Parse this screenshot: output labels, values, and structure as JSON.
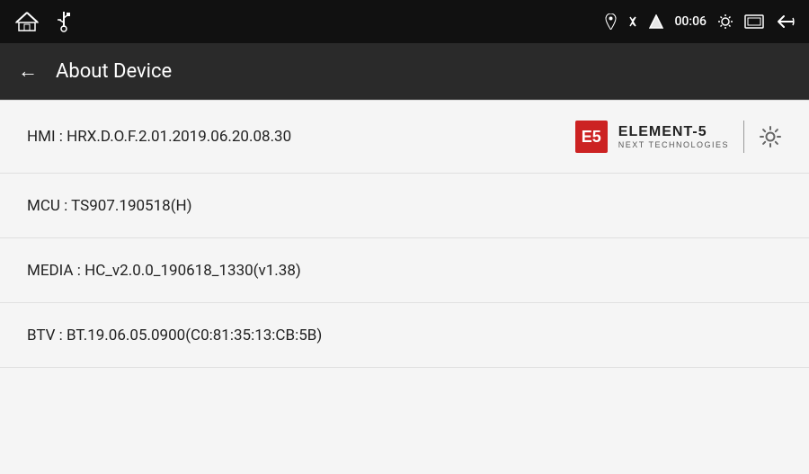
{
  "statusBar": {
    "time": "00:06",
    "icons": {
      "home": "⌂",
      "usb": "⚡",
      "gps": "◉",
      "bluetooth": "⚡",
      "signal": "▲",
      "brightness": "☀",
      "screen": "▭",
      "back": "↩"
    }
  },
  "navBar": {
    "backLabel": "←",
    "title": "About Device"
  },
  "rows": [
    {
      "id": "hmi",
      "label": "HMI : HRX.D.O.F.2.01.2019.06.20.08.30",
      "hasBrand": true
    },
    {
      "id": "mcu",
      "label": "MCU : TS907.190518(H)",
      "hasBrand": false
    },
    {
      "id": "media",
      "label": "MEDIA : HC_v2.0.0_190618_1330(v1.38)",
      "hasBrand": false
    },
    {
      "id": "btv",
      "label": "BTV : BT.19.06.05.0900(C0:81:35:13:CB:5B)",
      "hasBrand": false
    }
  ],
  "brand": {
    "logoText": "E5",
    "name": "ELEMENT-5",
    "sub": "NEXT TECHNOLOGIES"
  }
}
